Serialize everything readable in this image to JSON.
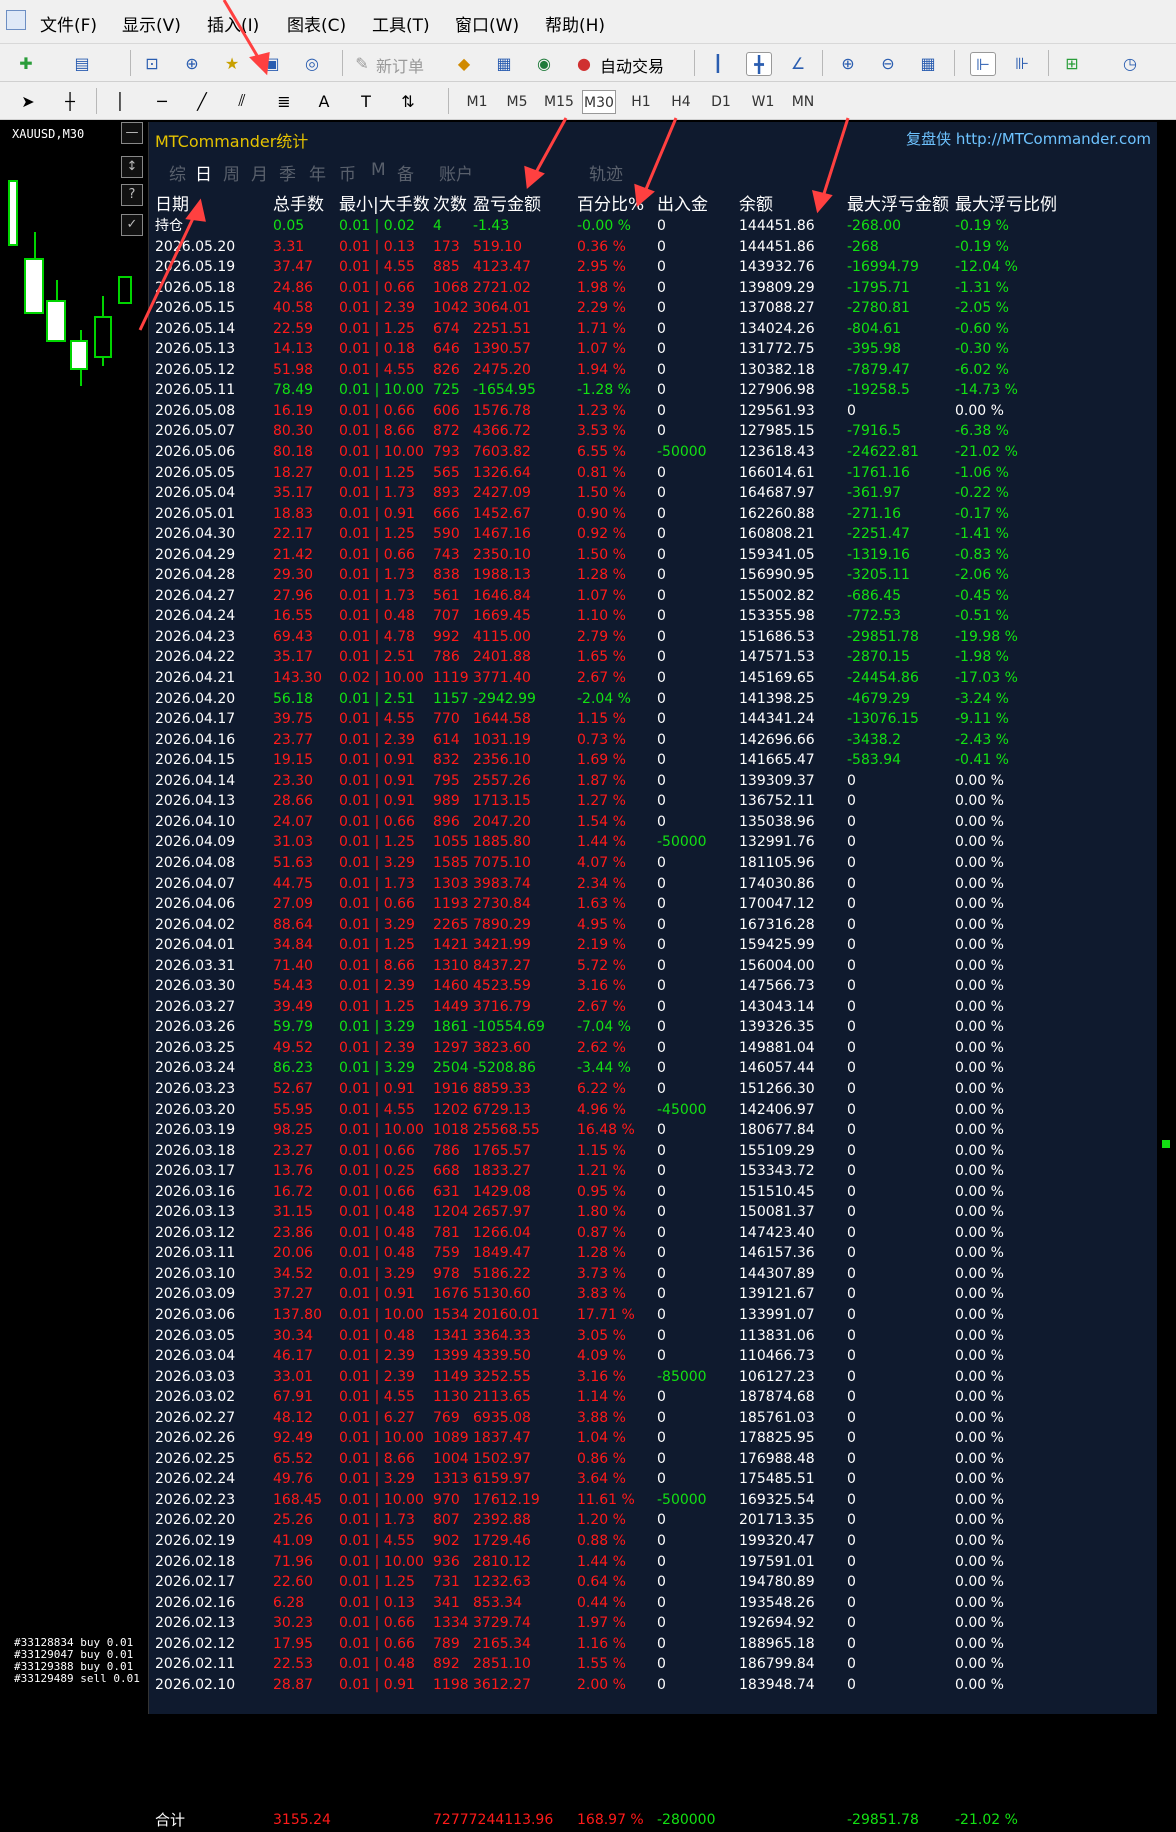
{
  "menu": {
    "items": [
      "文件(F)",
      "显示(V)",
      "插入(I)",
      "图表(C)",
      "工具(T)",
      "窗口(W)",
      "帮助(H)"
    ]
  },
  "toolbar": {
    "new_order_label": "新订单",
    "auto_trade_label": "自动交易",
    "timeframes": [
      "M1",
      "M5",
      "M15",
      "M30",
      "H1",
      "H4",
      "D1",
      "W1",
      "MN"
    ],
    "active_timeframe": "M30"
  },
  "chart": {
    "symbol_label": "XAUUSD,M30",
    "order_lines": [
      "#33128834 buy 0.01",
      "#33129047 buy 0.01",
      "#33129388 buy 0.01",
      "#33129489 sell 0.01"
    ]
  },
  "panel": {
    "title": "MTCommander统计",
    "brand": "复盘侠 http://MTCommander.com",
    "tabs": [
      "综",
      "日",
      "周",
      "月",
      "季",
      "年",
      "币",
      "M",
      "备",
      "账户",
      "轨迹"
    ],
    "active_tab": "日",
    "headers": {
      "date": "日期",
      "total_lots": "总手数",
      "min_max_lots": "最小|大手数",
      "count": "次数",
      "pl": "盈亏金额",
      "pct": "百分比%",
      "flow": "出入金",
      "balance": "余额",
      "max_float_amt": "最大浮亏金额",
      "max_float_pct": "最大浮亏比例"
    },
    "rows": [
      [
        "持仓",
        "0.05",
        "0.01 | 0.02",
        "4",
        "-1.43",
        "-0.00 %",
        "0",
        "144451.86",
        "-268.00",
        "-0.19 %"
      ],
      [
        "2026.05.20",
        "3.31",
        "0.01 | 0.13",
        "173",
        "519.10",
        "0.36 %",
        "0",
        "144451.86",
        "-268",
        "-0.19 %"
      ],
      [
        "2026.05.19",
        "37.47",
        "0.01 | 4.55",
        "885",
        "4123.47",
        "2.95 %",
        "0",
        "143932.76",
        "-16994.79",
        "-12.04 %"
      ],
      [
        "2026.05.18",
        "24.86",
        "0.01 | 0.66",
        "1068",
        "2721.02",
        "1.98 %",
        "0",
        "139809.29",
        "-1795.71",
        "-1.31 %"
      ],
      [
        "2026.05.15",
        "40.58",
        "0.01 | 2.39",
        "1042",
        "3064.01",
        "2.29 %",
        "0",
        "137088.27",
        "-2780.81",
        "-2.05 %"
      ],
      [
        "2026.05.14",
        "22.59",
        "0.01 | 1.25",
        "674",
        "2251.51",
        "1.71 %",
        "0",
        "134024.26",
        "-804.61",
        "-0.60 %"
      ],
      [
        "2026.05.13",
        "14.13",
        "0.01 | 0.18",
        "646",
        "1390.57",
        "1.07 %",
        "0",
        "131772.75",
        "-395.98",
        "-0.30 %"
      ],
      [
        "2026.05.12",
        "51.98",
        "0.01 | 4.55",
        "826",
        "2475.20",
        "1.94 %",
        "0",
        "130382.18",
        "-7879.47",
        "-6.02 %"
      ],
      [
        "2026.05.11",
        "78.49",
        "0.01 | 10.00",
        "725",
        "-1654.95",
        "-1.28 %",
        "0",
        "127906.98",
        "-19258.5",
        "-14.73 %"
      ],
      [
        "2026.05.08",
        "16.19",
        "0.01 | 0.66",
        "606",
        "1576.78",
        "1.23 %",
        "0",
        "129561.93",
        "0",
        "0.00 %"
      ],
      [
        "2026.05.07",
        "80.30",
        "0.01 | 8.66",
        "872",
        "4366.72",
        "3.53 %",
        "0",
        "127985.15",
        "-7916.5",
        "-6.38 %"
      ],
      [
        "2026.05.06",
        "80.18",
        "0.01 | 10.00",
        "793",
        "7603.82",
        "6.55 %",
        "-50000",
        "123618.43",
        "-24622.81",
        "-21.02 %"
      ],
      [
        "2026.05.05",
        "18.27",
        "0.01 | 1.25",
        "565",
        "1326.64",
        "0.81 %",
        "0",
        "166014.61",
        "-1761.16",
        "-1.06 %"
      ],
      [
        "2026.05.04",
        "35.17",
        "0.01 | 1.73",
        "893",
        "2427.09",
        "1.50 %",
        "0",
        "164687.97",
        "-361.97",
        "-0.22 %"
      ],
      [
        "2026.05.01",
        "18.83",
        "0.01 | 0.91",
        "666",
        "1452.67",
        "0.90 %",
        "0",
        "162260.88",
        "-271.16",
        "-0.17 %"
      ],
      [
        "2026.04.30",
        "22.17",
        "0.01 | 1.25",
        "590",
        "1467.16",
        "0.92 %",
        "0",
        "160808.21",
        "-2251.47",
        "-1.41 %"
      ],
      [
        "2026.04.29",
        "21.42",
        "0.01 | 0.66",
        "743",
        "2350.10",
        "1.50 %",
        "0",
        "159341.05",
        "-1319.16",
        "-0.83 %"
      ],
      [
        "2026.04.28",
        "29.30",
        "0.01 | 1.73",
        "838",
        "1988.13",
        "1.28 %",
        "0",
        "156990.95",
        "-3205.11",
        "-2.06 %"
      ],
      [
        "2026.04.27",
        "27.96",
        "0.01 | 1.73",
        "561",
        "1646.84",
        "1.07 %",
        "0",
        "155002.82",
        "-686.45",
        "-0.45 %"
      ],
      [
        "2026.04.24",
        "16.55",
        "0.01 | 0.48",
        "707",
        "1669.45",
        "1.10 %",
        "0",
        "153355.98",
        "-772.53",
        "-0.51 %"
      ],
      [
        "2026.04.23",
        "69.43",
        "0.01 | 4.78",
        "992",
        "4115.00",
        "2.79 %",
        "0",
        "151686.53",
        "-29851.78",
        "-19.98 %"
      ],
      [
        "2026.04.22",
        "35.17",
        "0.01 | 2.51",
        "786",
        "2401.88",
        "1.65 %",
        "0",
        "147571.53",
        "-2870.15",
        "-1.98 %"
      ],
      [
        "2026.04.21",
        "143.30",
        "0.02 | 10.00",
        "1119",
        "3771.40",
        "2.67 %",
        "0",
        "145169.65",
        "-24454.86",
        "-17.03 %"
      ],
      [
        "2026.04.20",
        "56.18",
        "0.01 | 2.51",
        "1157",
        "-2942.99",
        "-2.04 %",
        "0",
        "141398.25",
        "-4679.29",
        "-3.24 %"
      ],
      [
        "2026.04.17",
        "39.75",
        "0.01 | 4.55",
        "770",
        "1644.58",
        "1.15 %",
        "0",
        "144341.24",
        "-13076.15",
        "-9.11 %"
      ],
      [
        "2026.04.16",
        "23.77",
        "0.01 | 2.39",
        "614",
        "1031.19",
        "0.73 %",
        "0",
        "142696.66",
        "-3438.2",
        "-2.43 %"
      ],
      [
        "2026.04.15",
        "19.15",
        "0.01 | 0.91",
        "832",
        "2356.10",
        "1.69 %",
        "0",
        "141665.47",
        "-583.94",
        "-0.41 %"
      ],
      [
        "2026.04.14",
        "23.30",
        "0.01 | 0.91",
        "795",
        "2557.26",
        "1.87 %",
        "0",
        "139309.37",
        "0",
        "0.00 %"
      ],
      [
        "2026.04.13",
        "28.66",
        "0.01 | 0.91",
        "989",
        "1713.15",
        "1.27 %",
        "0",
        "136752.11",
        "0",
        "0.00 %"
      ],
      [
        "2026.04.10",
        "24.07",
        "0.01 | 0.66",
        "896",
        "2047.20",
        "1.54 %",
        "0",
        "135038.96",
        "0",
        "0.00 %"
      ],
      [
        "2026.04.09",
        "31.03",
        "0.01 | 1.25",
        "1055",
        "1885.80",
        "1.44 %",
        "-50000",
        "132991.76",
        "0",
        "0.00 %"
      ],
      [
        "2026.04.08",
        "51.63",
        "0.01 | 3.29",
        "1585",
        "7075.10",
        "4.07 %",
        "0",
        "181105.96",
        "0",
        "0.00 %"
      ],
      [
        "2026.04.07",
        "44.75",
        "0.01 | 1.73",
        "1303",
        "3983.74",
        "2.34 %",
        "0",
        "174030.86",
        "0",
        "0.00 %"
      ],
      [
        "2026.04.06",
        "27.09",
        "0.01 | 0.66",
        "1193",
        "2730.84",
        "1.63 %",
        "0",
        "170047.12",
        "0",
        "0.00 %"
      ],
      [
        "2026.04.02",
        "88.64",
        "0.01 | 3.29",
        "2265",
        "7890.29",
        "4.95 %",
        "0",
        "167316.28",
        "0",
        "0.00 %"
      ],
      [
        "2026.04.01",
        "34.84",
        "0.01 | 1.25",
        "1421",
        "3421.99",
        "2.19 %",
        "0",
        "159425.99",
        "0",
        "0.00 %"
      ],
      [
        "2026.03.31",
        "71.40",
        "0.01 | 8.66",
        "1310",
        "8437.27",
        "5.72 %",
        "0",
        "156004.00",
        "0",
        "0.00 %"
      ],
      [
        "2026.03.30",
        "54.43",
        "0.01 | 2.39",
        "1460",
        "4523.59",
        "3.16 %",
        "0",
        "147566.73",
        "0",
        "0.00 %"
      ],
      [
        "2026.03.27",
        "39.49",
        "0.01 | 1.25",
        "1449",
        "3716.79",
        "2.67 %",
        "0",
        "143043.14",
        "0",
        "0.00 %"
      ],
      [
        "2026.03.26",
        "59.79",
        "0.01 | 3.29",
        "1861",
        "-10554.69",
        "-7.04 %",
        "0",
        "139326.35",
        "0",
        "0.00 %"
      ],
      [
        "2026.03.25",
        "49.52",
        "0.01 | 2.39",
        "1297",
        "3823.60",
        "2.62 %",
        "0",
        "149881.04",
        "0",
        "0.00 %"
      ],
      [
        "2026.03.24",
        "86.23",
        "0.01 | 3.29",
        "2504",
        "-5208.86",
        "-3.44 %",
        "0",
        "146057.44",
        "0",
        "0.00 %"
      ],
      [
        "2026.03.23",
        "52.67",
        "0.01 | 0.91",
        "1916",
        "8859.33",
        "6.22 %",
        "0",
        "151266.30",
        "0",
        "0.00 %"
      ],
      [
        "2026.03.20",
        "55.95",
        "0.01 | 4.55",
        "1202",
        "6729.13",
        "4.96 %",
        "-45000",
        "142406.97",
        "0",
        "0.00 %"
      ],
      [
        "2026.03.19",
        "98.25",
        "0.01 | 10.00",
        "1018",
        "25568.55",
        "16.48 %",
        "0",
        "180677.84",
        "0",
        "0.00 %"
      ],
      [
        "2026.03.18",
        "23.27",
        "0.01 | 0.66",
        "786",
        "1765.57",
        "1.15 %",
        "0",
        "155109.29",
        "0",
        "0.00 %"
      ],
      [
        "2026.03.17",
        "13.76",
        "0.01 | 0.25",
        "668",
        "1833.27",
        "1.21 %",
        "0",
        "153343.72",
        "0",
        "0.00 %"
      ],
      [
        "2026.03.16",
        "16.72",
        "0.01 | 0.66",
        "631",
        "1429.08",
        "0.95 %",
        "0",
        "151510.45",
        "0",
        "0.00 %"
      ],
      [
        "2026.03.13",
        "31.15",
        "0.01 | 0.48",
        "1204",
        "2657.97",
        "1.80 %",
        "0",
        "150081.37",
        "0",
        "0.00 %"
      ],
      [
        "2026.03.12",
        "23.86",
        "0.01 | 0.48",
        "781",
        "1266.04",
        "0.87 %",
        "0",
        "147423.40",
        "0",
        "0.00 %"
      ],
      [
        "2026.03.11",
        "20.06",
        "0.01 | 0.48",
        "759",
        "1849.47",
        "1.28 %",
        "0",
        "146157.36",
        "0",
        "0.00 %"
      ],
      [
        "2026.03.10",
        "34.52",
        "0.01 | 3.29",
        "978",
        "5186.22",
        "3.73 %",
        "0",
        "144307.89",
        "0",
        "0.00 %"
      ],
      [
        "2026.03.09",
        "37.27",
        "0.01 | 0.91",
        "1676",
        "5130.60",
        "3.83 %",
        "0",
        "139121.67",
        "0",
        "0.00 %"
      ],
      [
        "2026.03.06",
        "137.80",
        "0.01 | 10.00",
        "1534",
        "20160.01",
        "17.71 %",
        "0",
        "133991.07",
        "0",
        "0.00 %"
      ],
      [
        "2026.03.05",
        "30.34",
        "0.01 | 0.48",
        "1341",
        "3364.33",
        "3.05 %",
        "0",
        "113831.06",
        "0",
        "0.00 %"
      ],
      [
        "2026.03.04",
        "46.17",
        "0.01 | 2.39",
        "1399",
        "4339.50",
        "4.09 %",
        "0",
        "110466.73",
        "0",
        "0.00 %"
      ],
      [
        "2026.03.03",
        "33.01",
        "0.01 | 2.39",
        "1149",
        "3252.55",
        "3.16 %",
        "-85000",
        "106127.23",
        "0",
        "0.00 %"
      ],
      [
        "2026.03.02",
        "67.91",
        "0.01 | 4.55",
        "1130",
        "2113.65",
        "1.14 %",
        "0",
        "187874.68",
        "0",
        "0.00 %"
      ],
      [
        "2026.02.27",
        "48.12",
        "0.01 | 6.27",
        "769",
        "6935.08",
        "3.88 %",
        "0",
        "185761.03",
        "0",
        "0.00 %"
      ],
      [
        "2026.02.26",
        "92.49",
        "0.01 | 10.00",
        "1089",
        "1837.47",
        "1.04 %",
        "0",
        "178825.95",
        "0",
        "0.00 %"
      ],
      [
        "2026.02.25",
        "65.52",
        "0.01 | 8.66",
        "1004",
        "1502.97",
        "0.86 %",
        "0",
        "176988.48",
        "0",
        "0.00 %"
      ],
      [
        "2026.02.24",
        "49.76",
        "0.01 | 3.29",
        "1313",
        "6159.97",
        "3.64 %",
        "0",
        "175485.51",
        "0",
        "0.00 %"
      ],
      [
        "2026.02.23",
        "168.45",
        "0.01 | 10.00",
        "970",
        "17612.19",
        "11.61 %",
        "-50000",
        "169325.54",
        "0",
        "0.00 %"
      ],
      [
        "2026.02.20",
        "25.26",
        "0.01 | 1.73",
        "807",
        "2392.88",
        "1.20 %",
        "0",
        "201713.35",
        "0",
        "0.00 %"
      ],
      [
        "2026.02.19",
        "41.09",
        "0.01 | 4.55",
        "902",
        "1729.46",
        "0.88 %",
        "0",
        "199320.47",
        "0",
        "0.00 %"
      ],
      [
        "2026.02.18",
        "71.96",
        "0.01 | 10.00",
        "936",
        "2810.12",
        "1.44 %",
        "0",
        "197591.01",
        "0",
        "0.00 %"
      ],
      [
        "2026.02.17",
        "22.60",
        "0.01 | 1.25",
        "731",
        "1232.63",
        "0.64 %",
        "0",
        "194780.89",
        "0",
        "0.00 %"
      ],
      [
        "2026.02.16",
        "6.28",
        "0.01 | 0.13",
        "341",
        "853.34",
        "0.44 %",
        "0",
        "193548.26",
        "0",
        "0.00 %"
      ],
      [
        "2026.02.13",
        "30.23",
        "0.01 | 0.66",
        "1334",
        "3729.74",
        "1.97 %",
        "0",
        "192694.92",
        "0",
        "0.00 %"
      ],
      [
        "2026.02.12",
        "17.95",
        "0.01 | 0.66",
        "789",
        "2165.34",
        "1.16 %",
        "0",
        "188965.18",
        "0",
        "0.00 %"
      ],
      [
        "2026.02.11",
        "22.53",
        "0.01 | 0.48",
        "892",
        "2851.10",
        "1.55 %",
        "0",
        "186799.84",
        "0",
        "0.00 %"
      ],
      [
        "2026.02.10",
        "28.87",
        "0.01 | 0.91",
        "1198",
        "3612.27",
        "2.00 %",
        "0",
        "183948.74",
        "0",
        "0.00 %"
      ]
    ],
    "total": {
      "label": "合计",
      "total_lots": "3155.24",
      "count_pl": "72777244113.96",
      "pct": "168.97 %",
      "flow": "-280000",
      "max_float_amt": "-29851.78",
      "max_float_pct": "-21.02 %"
    }
  },
  "colors": {
    "positive": "#ff1a1a",
    "negative": "#13e013",
    "panel_bg": "#0f1a2e",
    "title": "#e6c300",
    "brand": "#6ec3ff",
    "arrow": "#ff4040"
  }
}
